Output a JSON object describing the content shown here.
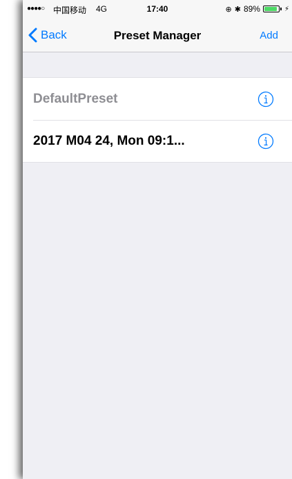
{
  "status_bar": {
    "signal": "●●●●○",
    "carrier": "中国移动",
    "network": "4G",
    "time": "17:40",
    "battery_percent": "89%",
    "battery_level": 0.89,
    "battery_color": "#4cd964"
  },
  "nav": {
    "back_label": "Back",
    "title": "Preset Manager",
    "add_label": "Add",
    "accent_color": "#007aff"
  },
  "presets": [
    {
      "name": "DefaultPreset",
      "style": "muted",
      "icon": "info-icon"
    },
    {
      "name": "2017 M04 24, Mon 09:1...",
      "style": "active",
      "icon": "info-icon"
    }
  ]
}
